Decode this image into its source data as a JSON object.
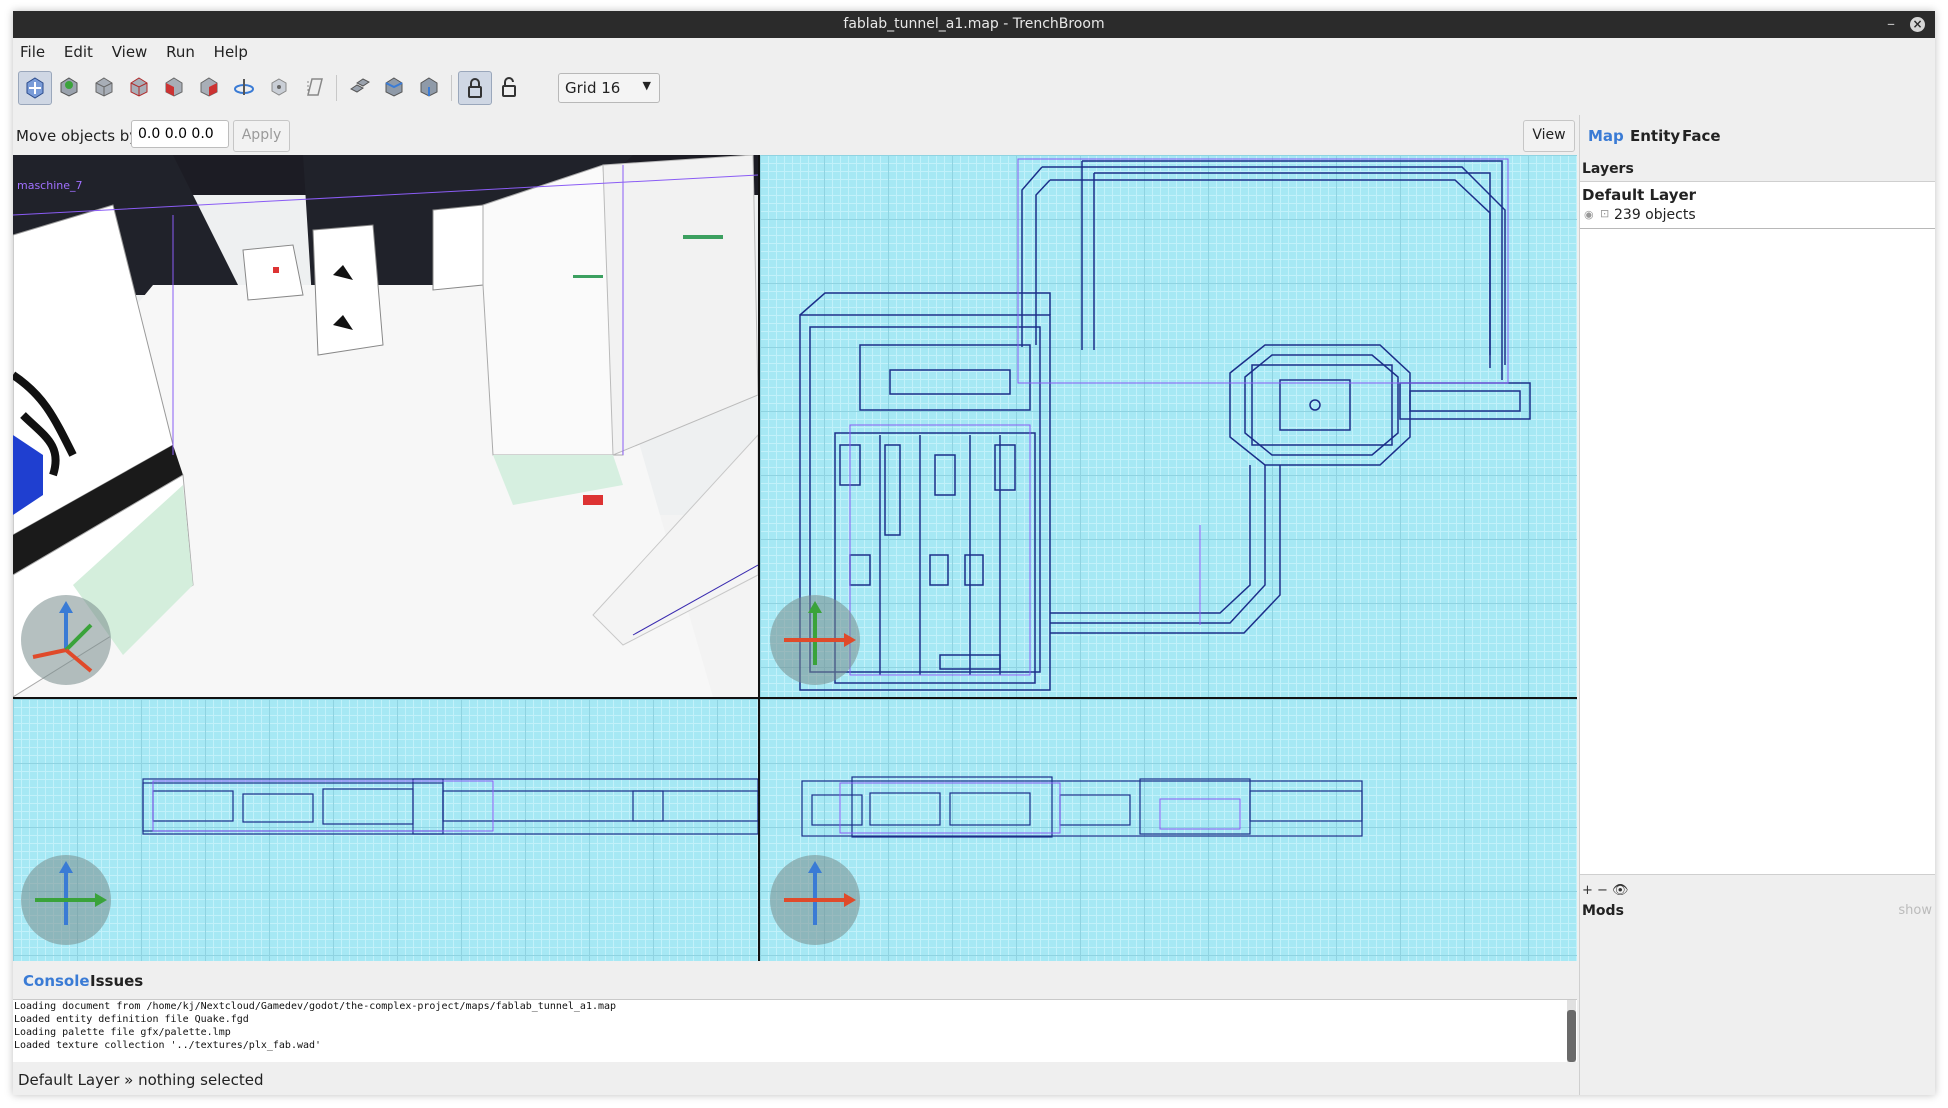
{
  "window": {
    "title": "fablab_tunnel_a1.map - TrenchBroom",
    "minimize_symbol": "–",
    "close_symbol": "×"
  },
  "menu": [
    "File",
    "Edit",
    "View",
    "Run",
    "Help"
  ],
  "toolbar": {
    "tools": [
      {
        "name": "move-tool-icon",
        "active": true
      },
      {
        "name": "vertex-tool-icon"
      },
      {
        "name": "brush-tool-icon"
      },
      {
        "name": "edge-tool-icon"
      },
      {
        "name": "face-tool-icon"
      },
      {
        "name": "clip-tool-icon"
      },
      {
        "name": "rotate-tool-icon"
      },
      {
        "name": "scale-tool-icon"
      },
      {
        "name": "shear-tool-icon"
      },
      {
        "name": "duplicate-icon"
      },
      {
        "name": "flip-horizontal-icon"
      },
      {
        "name": "flip-vertical-icon"
      },
      {
        "name": "lock-icon"
      },
      {
        "name": "unlock-icon"
      }
    ],
    "grid_select": "Grid 16"
  },
  "movebar": {
    "label": "Move objects by",
    "value": "0.0 0.0 0.0",
    "apply_label": "Apply",
    "view_label": "View"
  },
  "viewport3d": {
    "label": "maschine_7"
  },
  "console": {
    "tabs": {
      "console": "Console",
      "issues": "Issues"
    },
    "lines": [
      "Loading document from /home/kj/Nextcloud/Gamedev/godot/the-complex-project/maps/fablab_tunnel_a1.map",
      "Loaded entity definition file Quake.fgd",
      "Loading palette file gfx/palette.lmp",
      "Loaded texture collection '../textures/plx_fab.wad'"
    ]
  },
  "status": "Default Layer » nothing selected",
  "sidebar": {
    "tabs": {
      "map": "Map",
      "entity": "Entity",
      "face": "Face"
    },
    "layers_title": "Layers",
    "layer_name": "Default Layer",
    "layer_count": "239 objects",
    "layer_tools": "+ − 👁",
    "mods_title": "Mods",
    "mods_show": "show"
  },
  "colors": {
    "accent": "#3a7bd5",
    "grid_bg": "#a6e8f4",
    "wire": "#1c2f8a",
    "selection": "#8a5cf5"
  }
}
